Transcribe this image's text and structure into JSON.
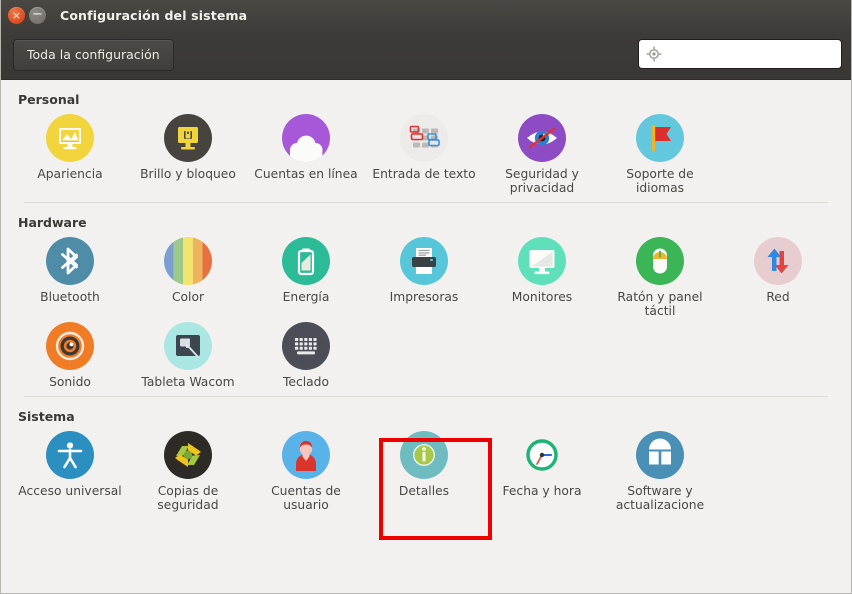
{
  "window": {
    "title": "Configuración del sistema",
    "close_label": "×",
    "minimize_label": "−"
  },
  "toolbar": {
    "all_settings_label": "Toda la configuración",
    "search_placeholder": "",
    "search_value": "",
    "search_icon": "target-search-icon"
  },
  "sections": [
    {
      "title": "Personal",
      "items": [
        {
          "label": "Apariencia",
          "icon": "appearance-icon",
          "color": "#f2d53c"
        },
        {
          "label": "Brillo y bloqueo",
          "icon": "brightness-lock-icon",
          "color": "#474440"
        },
        {
          "label": "Cuentas en línea",
          "icon": "online-accounts-icon",
          "color": "#a758d8"
        },
        {
          "label": "Entrada de texto",
          "icon": "text-entry-icon",
          "color": "#eceae8"
        },
        {
          "label": "Seguridad y privacidad",
          "icon": "security-privacy-icon",
          "color": "#8e4cc4"
        },
        {
          "label": "Soporte de idiomas",
          "icon": "language-support-icon",
          "color": "#63c7dd"
        }
      ]
    },
    {
      "title": "Hardware",
      "items": [
        {
          "label": "Bluetooth",
          "icon": "bluetooth-icon",
          "color": "#4f8ca8"
        },
        {
          "label": "Color",
          "icon": "color-icon",
          "color": "#d9d36a"
        },
        {
          "label": "Energía",
          "icon": "power-icon",
          "color": "#2bbb96"
        },
        {
          "label": "Impresoras",
          "icon": "printers-icon",
          "color": "#56c6d8"
        },
        {
          "label": "Monitores",
          "icon": "displays-icon",
          "color": "#5fe0bb"
        },
        {
          "label": "Ratón y panel táctil",
          "icon": "mouse-touchpad-icon",
          "color": "#3cb557"
        },
        {
          "label": "Red",
          "icon": "network-icon",
          "color": "#e8cdd0"
        },
        {
          "label": "Sonido",
          "icon": "sound-icon",
          "color": "#f07d26"
        },
        {
          "label": "Tableta Wacom",
          "icon": "wacom-tablet-icon",
          "color": "#aae7e2"
        },
        {
          "label": "Teclado",
          "icon": "keyboard-icon",
          "color": "#4b4e57"
        }
      ]
    },
    {
      "title": "Sistema",
      "items": [
        {
          "label": "Acceso universal",
          "icon": "universal-access-icon",
          "color": "#2b8fc0"
        },
        {
          "label": "Copias de seguridad",
          "icon": "backups-icon",
          "color": "#2e2b26"
        },
        {
          "label": "Cuentas de usuario",
          "icon": "user-accounts-icon",
          "color": "#59b3e8"
        },
        {
          "label": "Detalles",
          "icon": "details-icon",
          "color": "#6fbcc0",
          "highlighted": true
        },
        {
          "label": "Fecha y hora",
          "icon": "date-time-icon",
          "color": "#ffffff"
        },
        {
          "label": "Software y actualizacione",
          "icon": "software-updates-icon",
          "color": "#4a8fb5"
        }
      ]
    }
  ],
  "highlight": {
    "color": "#ee0000",
    "target_label": "Detalles"
  }
}
